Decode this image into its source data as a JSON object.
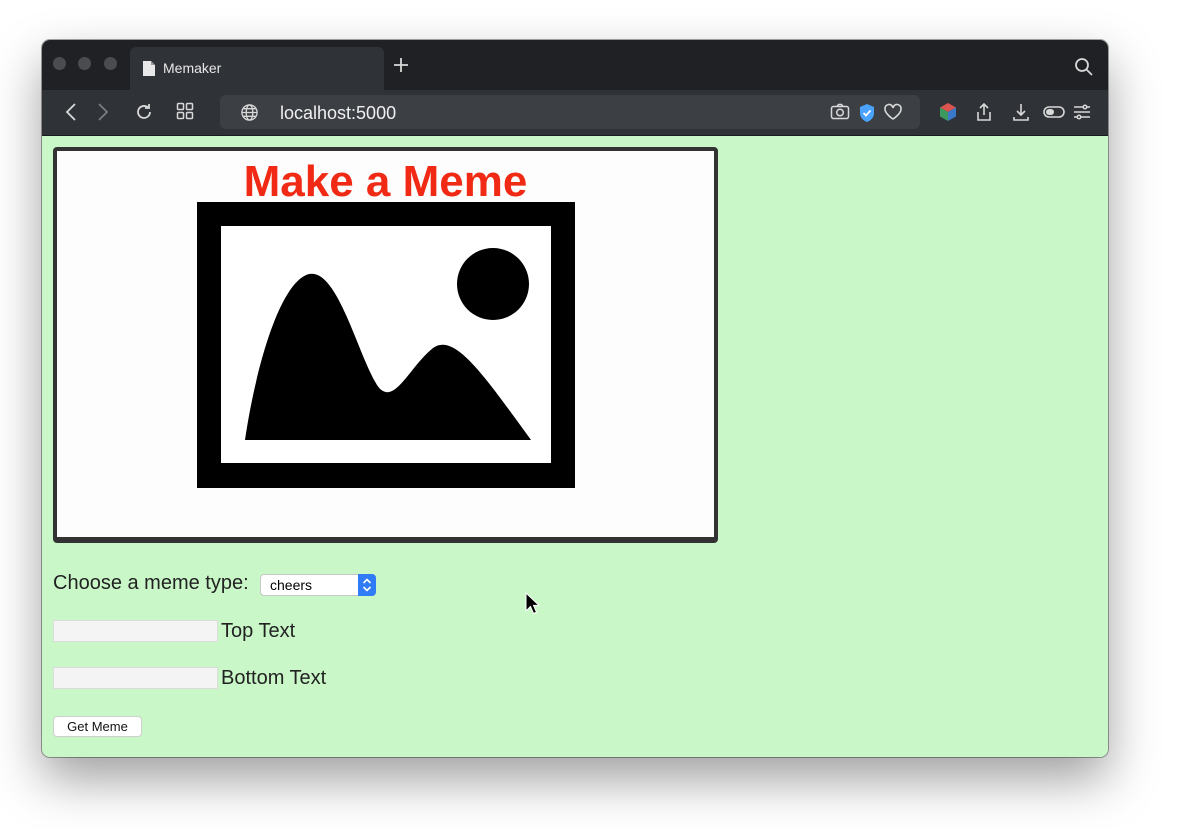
{
  "browser": {
    "tab_title": "Memaker",
    "url": "localhost:5000"
  },
  "page": {
    "meme_title": "Make a Meme",
    "meme_type_label": "Choose a meme type:",
    "meme_type_selected": "cheers",
    "top_text_label": "Top Text",
    "top_text_value": "",
    "bottom_text_label": "Bottom Text",
    "bottom_text_value": "",
    "get_meme_button": "Get Meme"
  },
  "colors": {
    "page_background": "#c9f7c8",
    "meme_title": "#f02a14",
    "select_accent": "#2f7cf6"
  },
  "icons": [
    "page-icon",
    "plus-icon",
    "search-icon",
    "back-icon",
    "forward-icon",
    "reload-icon",
    "tab-grid-icon",
    "globe-icon",
    "camera-icon",
    "shield-icon",
    "heart-icon",
    "cube-icon",
    "share-icon",
    "download-icon",
    "toggle-icon",
    "menu-icon",
    "image-placeholder-icon",
    "cursor-icon"
  ]
}
